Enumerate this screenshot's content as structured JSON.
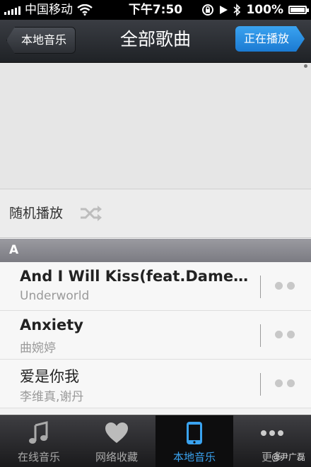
{
  "status_bar": {
    "carrier": "中国移动",
    "time": "下午7:50",
    "battery": "100%"
  },
  "nav": {
    "back_label": "本地音乐",
    "title": "全部歌曲",
    "now_playing_label": "正在播放"
  },
  "shuffle": {
    "label": "随机播放",
    "icon": "shuffle-icon"
  },
  "section": {
    "letter": "A"
  },
  "songs": [
    {
      "title": "And I Will Kiss(feat.Dame...",
      "artist": "Underworld"
    },
    {
      "title": "Anxiety",
      "artist": "曲婉婷"
    },
    {
      "title": "爱是你我",
      "artist": "李维真,谢丹"
    }
  ],
  "tabs": [
    {
      "label": "在线音乐",
      "icon": "music-note-icon",
      "active": false
    },
    {
      "label": "网络收藏",
      "icon": "heart-icon",
      "active": false
    },
    {
      "label": "本地音乐",
      "icon": "phone-icon",
      "active": true
    },
    {
      "label": "更多",
      "icon": "more-dots-icon",
      "active": false
    }
  ],
  "watermark": "@尹广磊",
  "colors": {
    "accent": "#3aa3f0",
    "navbar": "#2a2d32"
  }
}
